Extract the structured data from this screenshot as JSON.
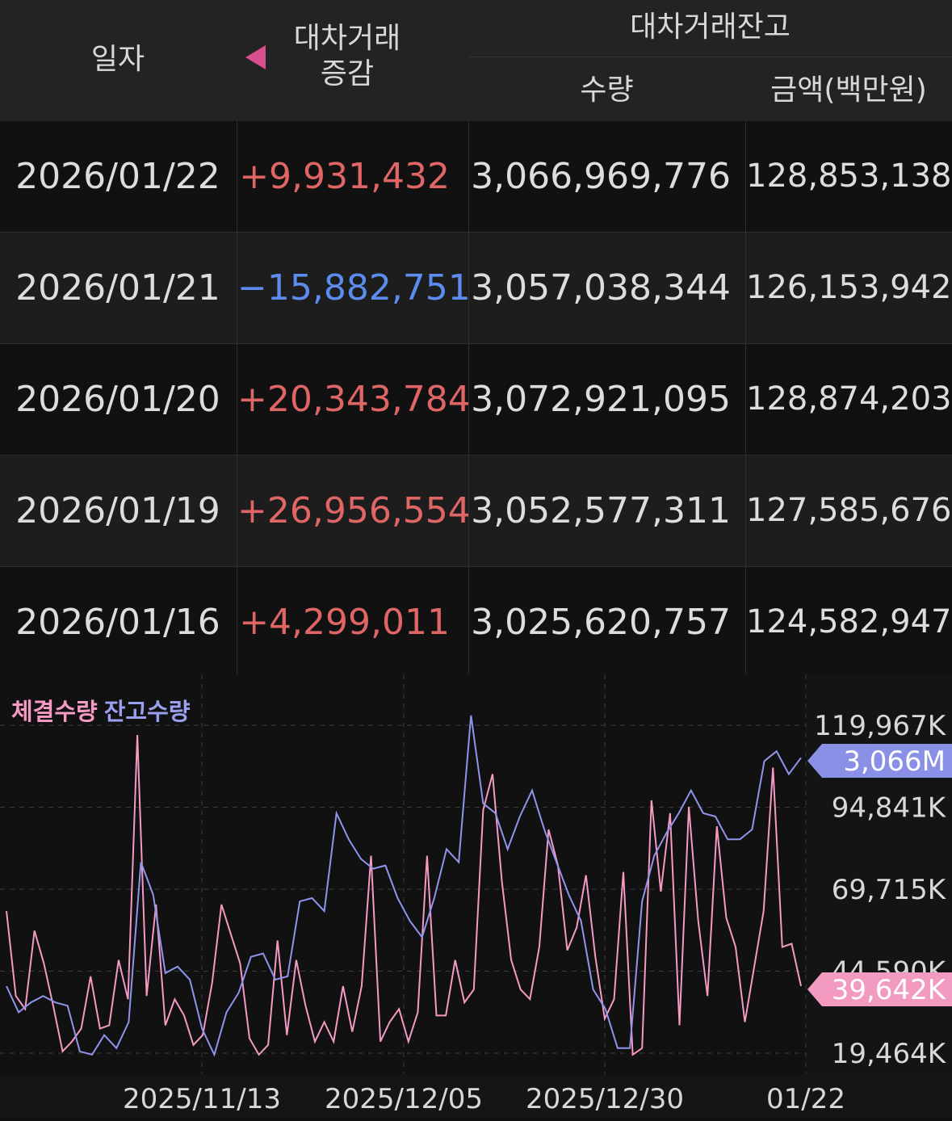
{
  "header": {
    "date": "일자",
    "change_line1": "대차거래",
    "change_line2": "증감",
    "balance": "대차거래잔고",
    "quantity": "수량",
    "amount": "금액(백만원)"
  },
  "rows": [
    {
      "date": "2026/01/22",
      "change": "+9,931,432",
      "direction": "up",
      "quantity": "3,066,969,776",
      "amount": "128,853,138"
    },
    {
      "date": "2026/01/21",
      "change": "−15,882,751",
      "direction": "down",
      "quantity": "3,057,038,344",
      "amount": "126,153,942"
    },
    {
      "date": "2026/01/20",
      "change": "+20,343,784",
      "direction": "up",
      "quantity": "3,072,921,095",
      "amount": "128,874,203"
    },
    {
      "date": "2026/01/19",
      "change": "+26,956,554",
      "direction": "up",
      "quantity": "3,052,577,311",
      "amount": "127,585,676"
    },
    {
      "date": "2026/01/16",
      "change": "+4,299,011",
      "direction": "up",
      "quantity": "3,025,620,757",
      "amount": "124,582,947"
    }
  ],
  "colors": {
    "up": "#e06666",
    "down": "#5d8cf0",
    "series_traded": "#f59ac3",
    "series_balance": "#8f95ec"
  },
  "chart_data": {
    "type": "line",
    "legend": [
      "체결수량",
      "잔고수량"
    ],
    "y_ticks": [
      "119,967K",
      "94,841K",
      "69,715K",
      "44,590K",
      "19,464K"
    ],
    "y_tick_values": [
      119967,
      94841,
      69715,
      44590,
      19464
    ],
    "x_ticks": [
      "2025/11/13",
      "2025/12/05",
      "2025/12/30",
      "01/22"
    ],
    "grid": true,
    "last_label_balance": "3,066M",
    "last_label_traded": "39,642K",
    "series": [
      {
        "name": "체결수량",
        "unit": "K",
        "values": [
          63000,
          37000,
          33000,
          57000,
          47000,
          34000,
          20000,
          23000,
          27000,
          43000,
          27000,
          28000,
          48000,
          36000,
          117000,
          37000,
          65000,
          28000,
          36000,
          31000,
          22000,
          25000,
          41000,
          65000,
          56000,
          47000,
          24000,
          19000,
          22000,
          54000,
          25000,
          48000,
          34000,
          23000,
          29000,
          23000,
          40000,
          26000,
          40000,
          80000,
          23000,
          29000,
          33000,
          23000,
          32000,
          80000,
          31000,
          31000,
          48000,
          35000,
          39000,
          94000,
          105000,
          72000,
          48000,
          39000,
          36000,
          52000,
          88000,
          77000,
          51000,
          58000,
          74000,
          49000,
          30000,
          36000,
          75000,
          19000,
          21000,
          97000,
          69000,
          93000,
          28000,
          95000,
          60000,
          37000,
          89000,
          61000,
          52000,
          29000,
          46000,
          63000,
          107000,
          52000,
          53000,
          40000
        ]
      },
      {
        "name": "잔고수량",
        "unit": "K",
        "values": [
          40000,
          32000,
          35000,
          37000,
          35000,
          34000,
          20000,
          19000,
          25000,
          21000,
          29000,
          78000,
          68000,
          44000,
          46000,
          42000,
          27000,
          19000,
          32000,
          38000,
          49000,
          50000,
          42000,
          43000,
          66000,
          67000,
          63000,
          93000,
          85000,
          79000,
          76000,
          77000,
          67000,
          60000,
          55000,
          67000,
          82000,
          78000,
          123000,
          96000,
          93000,
          82000,
          92000,
          100000,
          88000,
          78000,
          68000,
          60000,
          39000,
          33000,
          21000,
          21000,
          66000,
          80000,
          87000,
          93000,
          100000,
          93000,
          92000,
          85000,
          85000,
          88000,
          109000,
          112000,
          105000,
          110000
        ]
      }
    ]
  }
}
